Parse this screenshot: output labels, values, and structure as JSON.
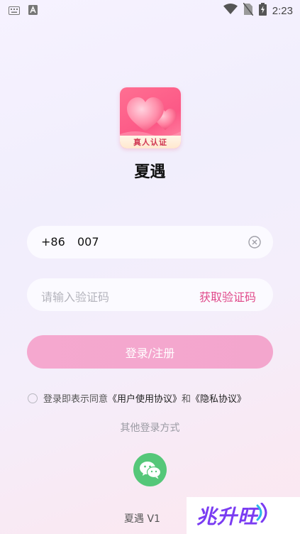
{
  "status_bar": {
    "time": "2:23",
    "icons": [
      "keyboard-icon",
      "font-a-icon",
      "wifi-icon",
      "no-sim-icon",
      "battery-charging-icon"
    ]
  },
  "app": {
    "name": "夏遇",
    "logo_badge": "真人认证"
  },
  "login_form": {
    "country_code": "+86",
    "phone_value": "007",
    "code_placeholder": "请输入验证码",
    "get_code_label": "获取验证码",
    "login_label": "登录/注册"
  },
  "agreement": {
    "prefix": "登录即表示同意",
    "user_agreement": "《用户使用协议》",
    "conjunction": "和",
    "privacy_policy": "《隐私协议》"
  },
  "other_login": {
    "title": "其他登录方式",
    "methods": [
      "wechat-icon"
    ]
  },
  "footer": {
    "version": "夏遇 V1"
  },
  "watermark": {
    "text": "兆升旺"
  },
  "colors": {
    "accent": "#e04a8a",
    "login_button": "#f5a8cf",
    "wechat": "#55c779",
    "logo": "#fc5886"
  }
}
